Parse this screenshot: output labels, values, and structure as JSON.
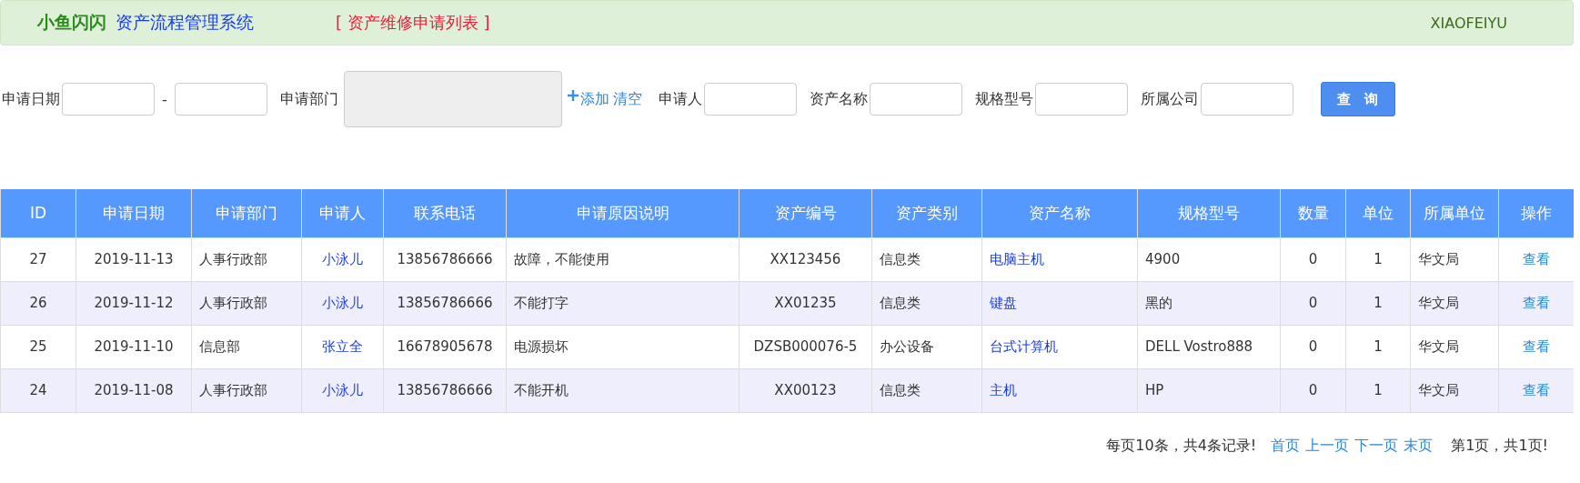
{
  "header": {
    "brand": "小鱼闪闪",
    "system": "资产流程管理系统",
    "page": "[ 资产维修申请列表 ]",
    "user": "XIAOFEIYU"
  },
  "filters": [
    {
      "kind": "range",
      "label": "申请日期",
      "separator": "-"
    },
    {
      "kind": "dept",
      "label": "申请部门",
      "add": "添加",
      "clear": "清空"
    },
    {
      "kind": "input",
      "label": "申请人"
    },
    {
      "kind": "input",
      "label": "资产名称"
    },
    {
      "kind": "input",
      "label": "规格型号"
    },
    {
      "kind": "input",
      "label": "所属公司"
    }
  ],
  "search_button": "查　询",
  "table": {
    "columns": [
      "ID",
      "申请日期",
      "申请部门",
      "申请人",
      "联系电话",
      "申请原因说明",
      "资产编号",
      "资产类别",
      "资产名称",
      "规格型号",
      "数量",
      "单位",
      "所属单位",
      "操作"
    ],
    "rows": [
      [
        "27",
        "2019-11-13",
        "人事行政部",
        "小泳儿",
        "13856786666",
        "故障，不能使用",
        "XX123456",
        "信息类",
        "电脑主机",
        "4900",
        "0",
        "1",
        "华文局",
        "查看"
      ],
      [
        "26",
        "2019-11-12",
        "人事行政部",
        "小泳儿",
        "13856786666",
        "不能打字",
        "XX01235",
        "信息类",
        "键盘",
        "黑的",
        "0",
        "1",
        "华文局",
        "查看"
      ],
      [
        "25",
        "2019-11-10",
        "信息部",
        "张立全",
        "16678905678",
        "电源损坏",
        "DZSB000076-5",
        "办公设备",
        "台式计算机",
        "DELL Vostro888",
        "0",
        "1",
        "华文局",
        "查看"
      ],
      [
        "24",
        "2019-11-08",
        "人事行政部",
        "小泳儿",
        "13856786666",
        "不能开机",
        "XX00123",
        "信息类",
        "主机",
        "HP",
        "0",
        "1",
        "华文局",
        "查看"
      ]
    ]
  },
  "pagination": {
    "summary": "每页10条，共4条记录!",
    "links": [
      "首页",
      "上一页",
      "下一页",
      "末页"
    ],
    "status": "第1页，共1页!"
  }
}
